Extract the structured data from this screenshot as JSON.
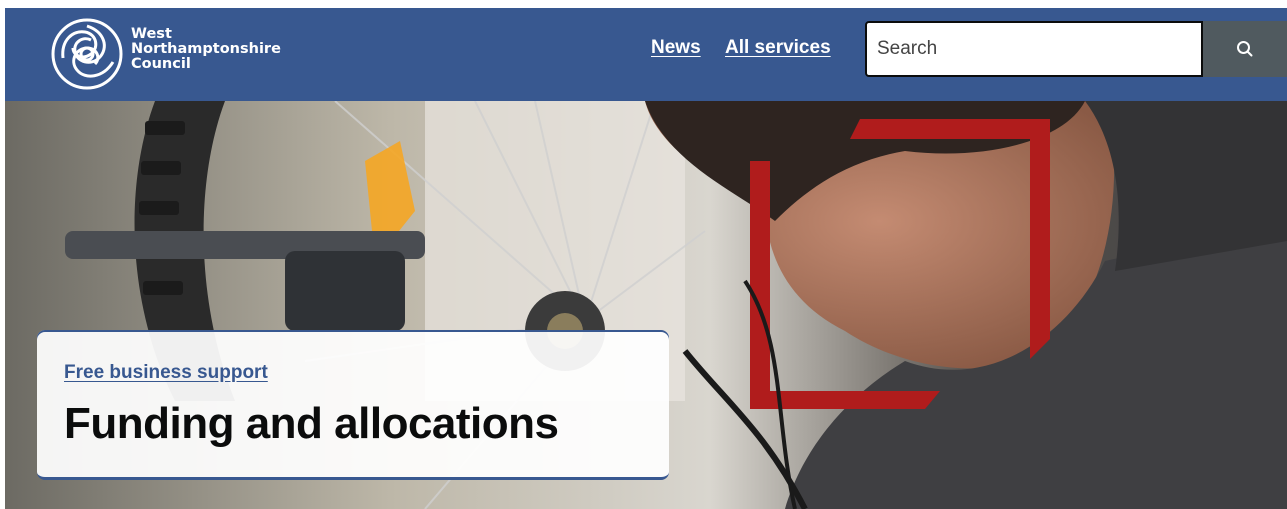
{
  "header": {
    "logo_lines": [
      "West",
      "Northamptonshire",
      "Council"
    ],
    "nav": [
      {
        "label": "News"
      },
      {
        "label": "All services"
      }
    ],
    "search": {
      "placeholder": "Search",
      "value": ""
    }
  },
  "hero": {
    "link_label": "Free business support",
    "title": "Funding and allocations"
  },
  "colors": {
    "header_bg": "#385890",
    "search_button_bg": "#505a5f",
    "accent_red": "#b01c1c"
  }
}
